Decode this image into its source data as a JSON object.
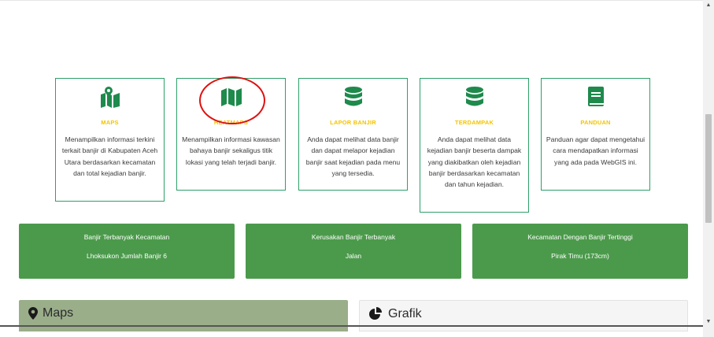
{
  "cards": [
    {
      "title": "MAPS",
      "icon": "map-marked-icon",
      "desc": "Menampilkan informasi terkini terkait banjir di Kabupaten Aceh Utara berdasarkan kecamatan dan total kejadian banjir."
    },
    {
      "title": "HEATMAPS",
      "icon": "map-icon",
      "desc": "Menampilkan informasi kawasan bahaya banjir sekaligus titik lokasi yang telah terjadi banjir."
    },
    {
      "title": "LAPOR BANJIR",
      "icon": "database-icon",
      "desc": "Anda dapat melihat data banjir dan dapat melapor kejadian banjir saat kejadian pada menu yang tersedia."
    },
    {
      "title": "TERDAMPAK",
      "icon": "database-icon",
      "desc": "Anda dapat melihat data kejadian banjir beserta dampak yang diakibatkan oleh kejadian banjir berdasarkan kecamatan dan tahun kejadian."
    },
    {
      "title": "PANDUAN",
      "icon": "book-icon",
      "desc": "Panduan agar dapat mengetahui cara mendapatkan informasi yang ada pada WebGIS ini."
    }
  ],
  "stats": [
    {
      "label": "Banjir Terbanyak Kecamatan",
      "value": "Lhoksukon Jumlah Banjir 6"
    },
    {
      "label": "Kerusakan Banjir Terbanyak",
      "value": "Jalan"
    },
    {
      "label": "Kecamatan Dengan Banjir Tertinggi",
      "value": "Pirak Timu (173cm)"
    }
  ],
  "panels": {
    "maps_title": "Maps",
    "grafik_title": "Grafik"
  },
  "colors": {
    "card_border": "#2e9f6a",
    "icon_green": "#1e8a4c",
    "title_yellow": "#f2c400",
    "stat_bg": "#4b9a4b",
    "maps_panel_bg": "#9aae8a",
    "grafik_panel_bg": "#f5f5f5",
    "annotation_red": "#e01010"
  }
}
